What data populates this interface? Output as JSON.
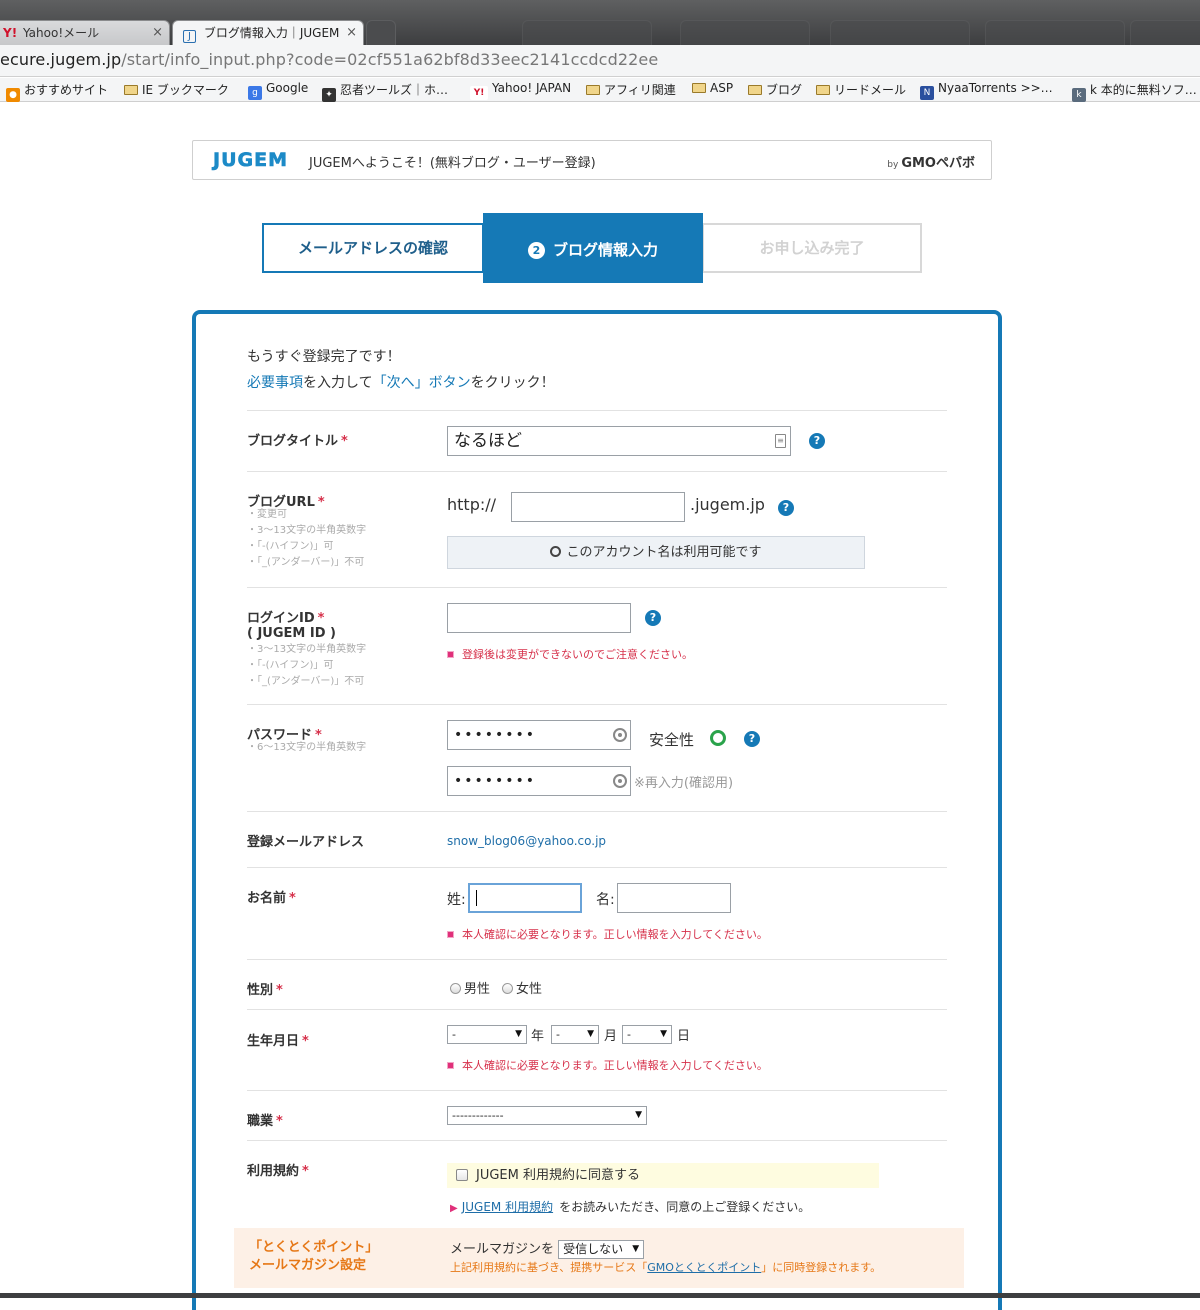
{
  "browser": {
    "tabs": [
      {
        "title": "Yahoo!メール",
        "close": "×"
      },
      {
        "title": "ブログ情報入力｜JUGEM",
        "close": "×"
      }
    ],
    "url_host": "ecure.jugem.jp",
    "url_path": "/start/info_input.php?code=02cf551a62bf8d33eec2141ccdcd22ee",
    "bookmarks": [
      {
        "label": "おすすめサイト",
        "icon": "bulb-icon"
      },
      {
        "label": "IE ブックマーク",
        "icon": "folder-icon"
      },
      {
        "label": "Google",
        "icon": "google-icon"
      },
      {
        "label": "忍者ツールズ｜ホ…",
        "icon": "ninja-icon"
      },
      {
        "label": "Yahoo! JAPAN",
        "icon": "yahoo-icon"
      },
      {
        "label": "アフィリ関連",
        "icon": "folder-icon"
      },
      {
        "label": "ASP",
        "icon": "folder-icon"
      },
      {
        "label": "ブログ",
        "icon": "folder-icon"
      },
      {
        "label": "リードメール",
        "icon": "folder-icon"
      },
      {
        "label": "NyaaTorrents >>…",
        "icon": "nyaa-icon"
      },
      {
        "label": "k 本的に無料ソフ…",
        "icon": "k-icon"
      }
    ]
  },
  "header": {
    "logo": "JUGEM",
    "welcome": "JUGEMへようこそ！(無料ブログ・ユーザー登録)",
    "by": "by",
    "gmo": "GMOペパボ"
  },
  "steps": [
    {
      "label": "メールアドレスの確認"
    },
    {
      "num": "2",
      "label": "ブログ情報入力"
    },
    {
      "label": "お申し込み完了"
    }
  ],
  "intro": {
    "line1": "もうすぐ登録完了です！",
    "line2_a": "必要事項",
    "line2_b": "を入力して",
    "line2_c": "「次へ」ボタン",
    "line2_d": "をクリック！"
  },
  "form": {
    "required_mark": "*",
    "help": "?",
    "blog_title": {
      "label": "ブログタイトル",
      "value": "なるほど"
    },
    "blog_url": {
      "label": "ブログURL",
      "notes": [
        "・変更可",
        "・3～13文字の半角英数字",
        "・「-(ハイフン)」可",
        "・「_(アンダーバー)」不可"
      ],
      "prefix": "http://",
      "suffix": ".jugem.jp",
      "value": "",
      "availability": "このアカウント名は利用可能です"
    },
    "login_id": {
      "label": "ログインID",
      "label2": "( JUGEM ID )",
      "notes": [
        "・3～13文字の半角英数字",
        "・「-(ハイフン)」可",
        "・「_(アンダーバー)」不可"
      ],
      "value": "",
      "warning": "登録後は変更ができないのでご注意ください。"
    },
    "password": {
      "label": "パスワード",
      "notes": [
        "・6～13文字の半角英数字"
      ],
      "value": "••••••••",
      "confirm_value": "••••••••",
      "strength_label": "安全性",
      "confirm_note": "※再入力(確認用)"
    },
    "email": {
      "label": "登録メールアドレス",
      "value": "snow_blog06@yahoo.co.jp"
    },
    "name": {
      "label": "お名前",
      "last_label": "姓:",
      "first_label": "名:",
      "last_value": "",
      "first_value": "",
      "warning": "本人確認に必要となります。正しい情報を入力してください。"
    },
    "gender": {
      "label": "性別",
      "options": [
        "男性",
        "女性"
      ]
    },
    "birthday": {
      "label": "生年月日",
      "year_value": "-",
      "year_unit": "年",
      "month_value": "-",
      "month_unit": "月",
      "day_value": "-",
      "day_unit": "日",
      "warning": "本人確認に必要となります。正しい情報を入力してください。"
    },
    "job": {
      "label": "職業",
      "value": "-------------"
    },
    "terms": {
      "label": "利用規約",
      "checkbox_label": "JUGEM 利用規約に同意する",
      "link": "JUGEM 利用規約",
      "after_link": "をお読みいただき、同意の上ご登録ください。"
    },
    "promo": {
      "label_line1": "「とくとくポイント」",
      "label_line2": "メールマガジン設定",
      "mm_label": "メールマガジンを",
      "mm_value": "受信しない",
      "note_a": "上記利用規約に基づき、提携サービス「",
      "note_link": "GMOとくとくポイント",
      "note_b": "」に同時登録されます。"
    }
  },
  "colors": {
    "brand_blue": "#1579b6",
    "required_red": "#d6304a",
    "promo_orange": "#e67817",
    "strength_green": "#2aa34b"
  }
}
